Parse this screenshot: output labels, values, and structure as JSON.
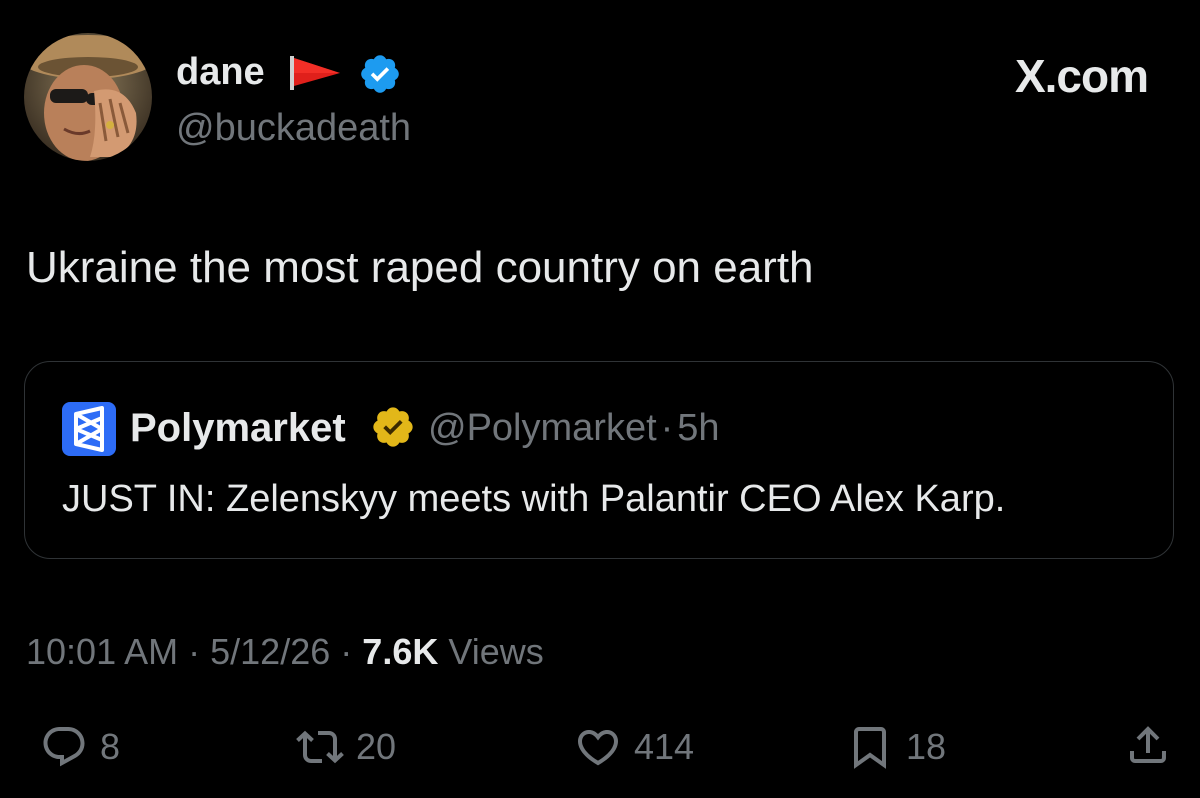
{
  "author": {
    "display_name": "dane",
    "handle": "@buckadeath",
    "verified": true,
    "flag_icon": "red-flag-icon",
    "avatar": "avatar-image"
  },
  "site_label": "X.com",
  "tweet": {
    "text": "Ukraine the most raped country on earth"
  },
  "quote": {
    "name": "Polymarket",
    "badge": "gold-verified-badge-icon",
    "handle": "@Polymarket",
    "separator": "·",
    "age": "5h",
    "text": "JUST IN: Zelenskyy meets with Palantir CEO Alex Karp."
  },
  "meta": {
    "time": "10:01 AM",
    "date": "5/12/26",
    "separator": "·",
    "views_count": "7.6K",
    "views_label": "Views"
  },
  "actions": {
    "replies": "8",
    "reposts": "20",
    "likes": "414",
    "bookmarks": "18"
  },
  "colors": {
    "background": "#000000",
    "text": "#e7e9ea",
    "muted": "#71767b",
    "verified_blue": "#1d9bf0",
    "verified_gold": "#e2b719",
    "polymarket_blue": "#2d6cf6",
    "flag_red": "#e0201b"
  }
}
